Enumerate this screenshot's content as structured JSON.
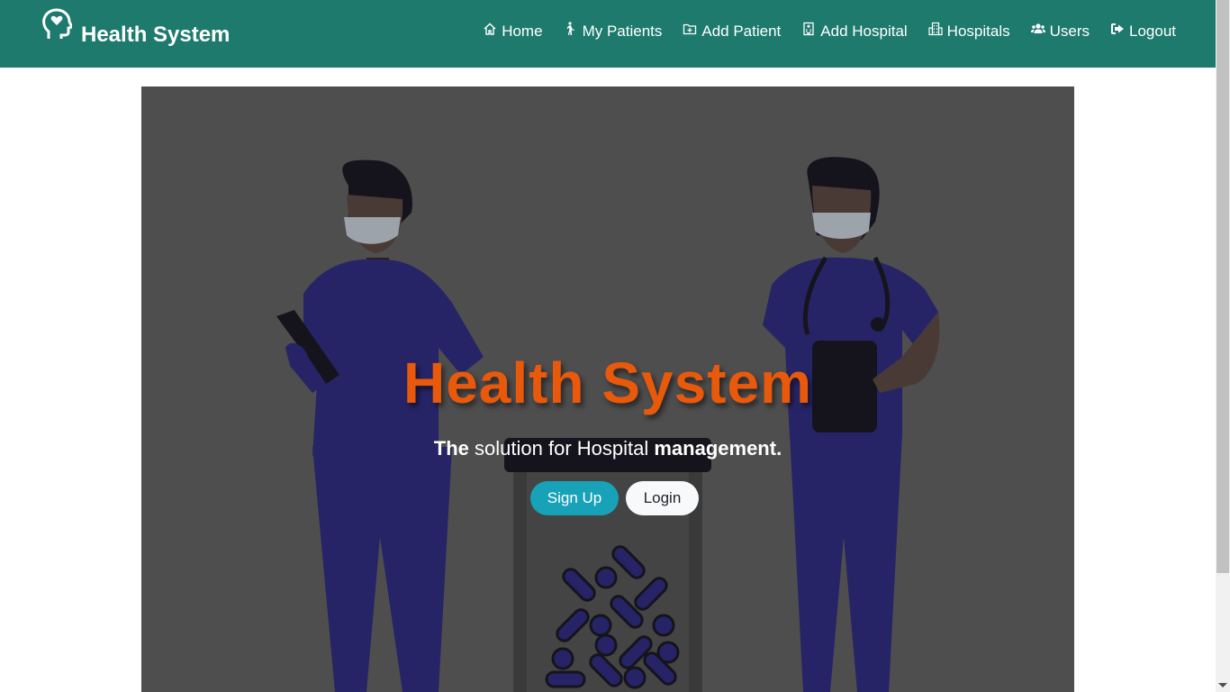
{
  "brand": {
    "title": "Health System",
    "icon": "head-heart-icon"
  },
  "nav": {
    "items": [
      {
        "label": "Home",
        "icon": "home-icon"
      },
      {
        "label": "My Patients",
        "icon": "walking-person-icon"
      },
      {
        "label": "Add Patient",
        "icon": "folder-plus-icon"
      },
      {
        "label": "Add Hospital",
        "icon": "hospital-building-icon"
      },
      {
        "label": "Hospitals",
        "icon": "city-icon"
      },
      {
        "label": "Users",
        "icon": "users-icon"
      },
      {
        "label": "Logout",
        "icon": "sign-out-icon"
      }
    ]
  },
  "hero": {
    "title": "Health System",
    "tagline": {
      "bold1": "The",
      "middle": " solution for Hospital ",
      "bold2": "management",
      "end": "."
    },
    "buttons": {
      "signup": "Sign Up",
      "login": "Login"
    }
  },
  "colors": {
    "navbar": "#1e7a6d",
    "title": "#e8590c",
    "signup": "#17a2b8",
    "hero_bg": "#4e4e4e"
  }
}
